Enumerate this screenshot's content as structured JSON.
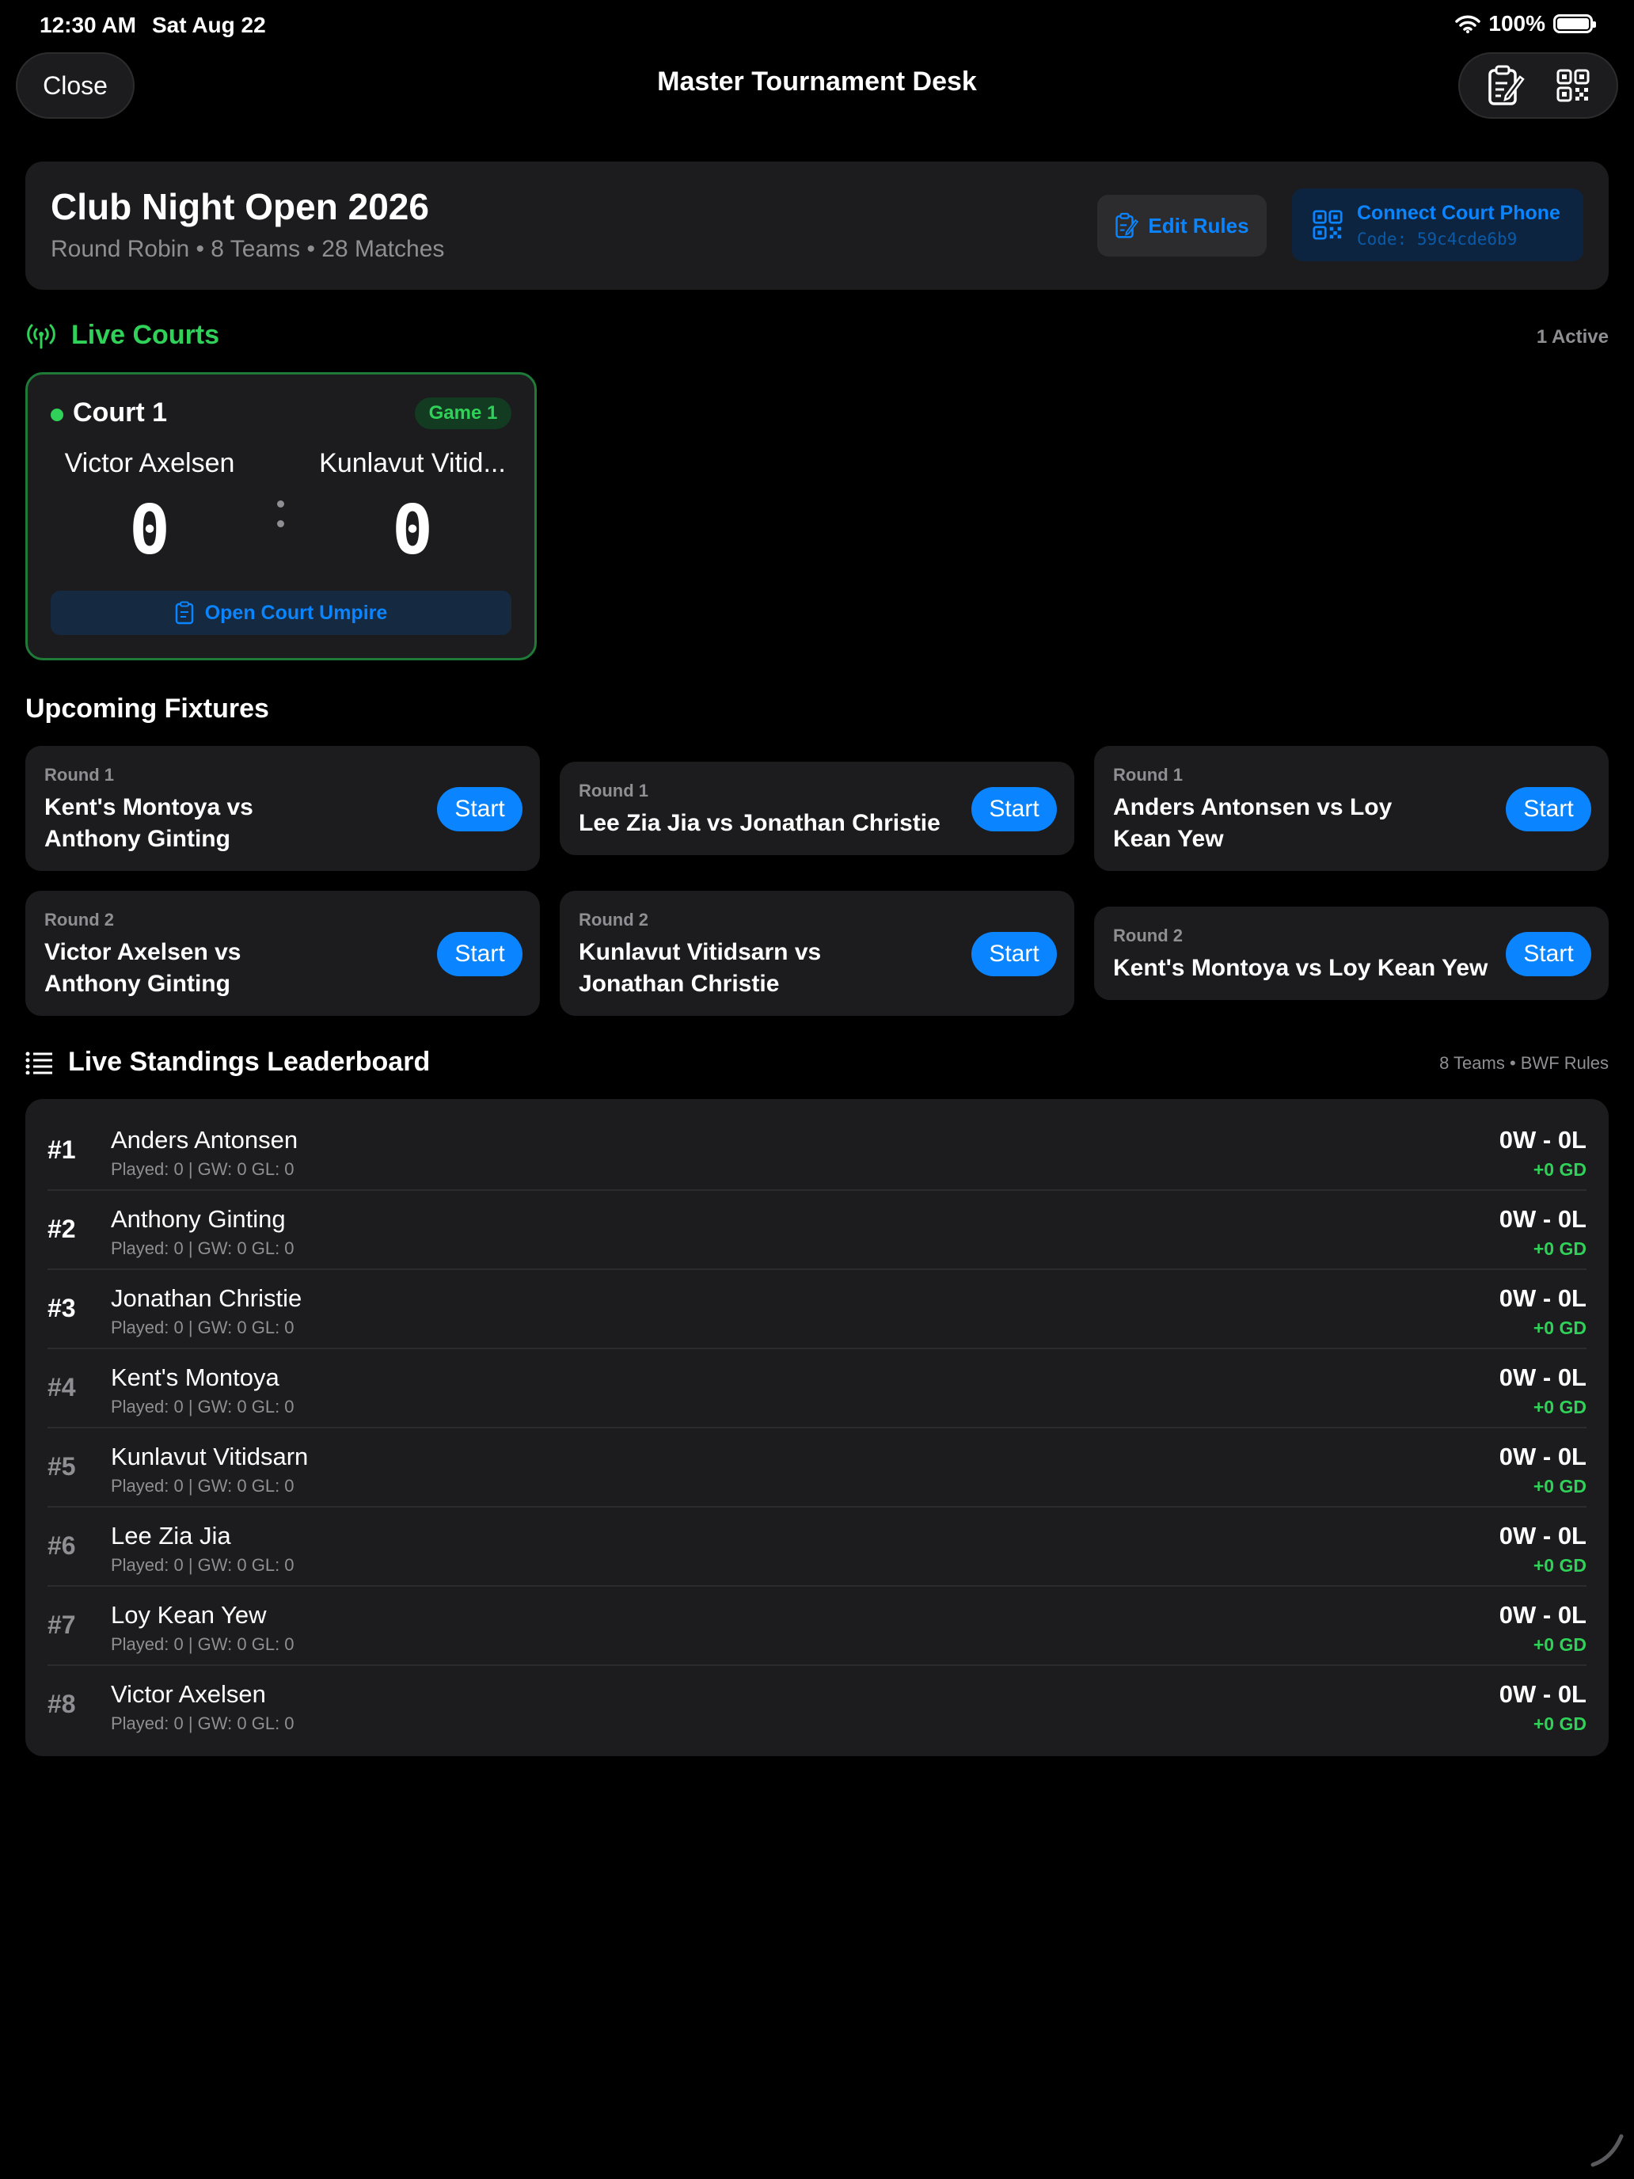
{
  "status_bar": {
    "time": "12:30 AM",
    "date": "Sat Aug 22",
    "battery": "100%"
  },
  "nav": {
    "close_label": "Close",
    "title": "Master Tournament Desk"
  },
  "tournament": {
    "name": "Club Night Open 2026",
    "meta": "Round Robin • 8 Teams • 28 Matches",
    "edit_rules_label": "Edit Rules",
    "connect_label": "Connect Court Phone",
    "connect_code": "Code: 59c4cde6b9"
  },
  "live_courts": {
    "title": "Live Courts",
    "active_count": "1 Active",
    "court": {
      "name": "Court 1",
      "game": "Game 1",
      "player_a": "Victor Axelsen",
      "player_b": "Kunlavut Vitid...",
      "score_a": "0",
      "score_b": "0",
      "umpire_label": "Open Court Umpire"
    }
  },
  "upcoming": {
    "title": "Upcoming Fixtures",
    "start_label": "Start",
    "fixtures": [
      {
        "round": "Round 1",
        "match_line1": "Kent's Montoya vs",
        "match_line2": "Anthony Ginting"
      },
      {
        "round": "Round 1",
        "match_line1": "Lee Zia Jia vs Jonathan Christie",
        "match_line2": ""
      },
      {
        "round": "Round 1",
        "match_line1": "Anders Antonsen vs Loy",
        "match_line2": "Kean Yew"
      },
      {
        "round": "Round 2",
        "match_line1": "Victor Axelsen vs",
        "match_line2": "Anthony Ginting"
      },
      {
        "round": "Round 2",
        "match_line1": "Kunlavut Vitidsarn vs",
        "match_line2": "Jonathan Christie"
      },
      {
        "round": "Round 2",
        "match_line1": "Kent's Montoya vs Loy Kean Yew",
        "match_line2": ""
      }
    ]
  },
  "leaderboard": {
    "title": "Live Standings Leaderboard",
    "meta": "8 Teams • BWF Rules",
    "rows": [
      {
        "rank": "#1",
        "name": "Anders Antonsen",
        "stats": "Played: 0 | GW: 0 GL: 0",
        "record": "0W - 0L",
        "gd": "+0 GD"
      },
      {
        "rank": "#2",
        "name": "Anthony Ginting",
        "stats": "Played: 0 | GW: 0 GL: 0",
        "record": "0W - 0L",
        "gd": "+0 GD"
      },
      {
        "rank": "#3",
        "name": "Jonathan Christie",
        "stats": "Played: 0 | GW: 0 GL: 0",
        "record": "0W - 0L",
        "gd": "+0 GD"
      },
      {
        "rank": "#4",
        "name": "Kent's Montoya",
        "stats": "Played: 0 | GW: 0 GL: 0",
        "record": "0W - 0L",
        "gd": "+0 GD"
      },
      {
        "rank": "#5",
        "name": "Kunlavut Vitidsarn",
        "stats": "Played: 0 | GW: 0 GL: 0",
        "record": "0W - 0L",
        "gd": "+0 GD"
      },
      {
        "rank": "#6",
        "name": "Lee Zia Jia",
        "stats": "Played: 0 | GW: 0 GL: 0",
        "record": "0W - 0L",
        "gd": "+0 GD"
      },
      {
        "rank": "#7",
        "name": "Loy Kean Yew",
        "stats": "Played: 0 | GW: 0 GL: 0",
        "record": "0W - 0L",
        "gd": "+0 GD"
      },
      {
        "rank": "#8",
        "name": "Victor Axelsen",
        "stats": "Played: 0 | GW: 0 GL: 0",
        "record": "0W - 0L",
        "gd": "+0 GD"
      }
    ]
  },
  "colors": {
    "accent": "#0a84ff",
    "live_green": "#30d158",
    "card": "#1c1c1e",
    "secondary_text": "#8e8e93"
  },
  "icons": [
    "wifi-icon",
    "battery-icon",
    "edit-rules-icon",
    "qr-code-icon",
    "antenna-icon",
    "clipboard-icon",
    "list-icon"
  ]
}
